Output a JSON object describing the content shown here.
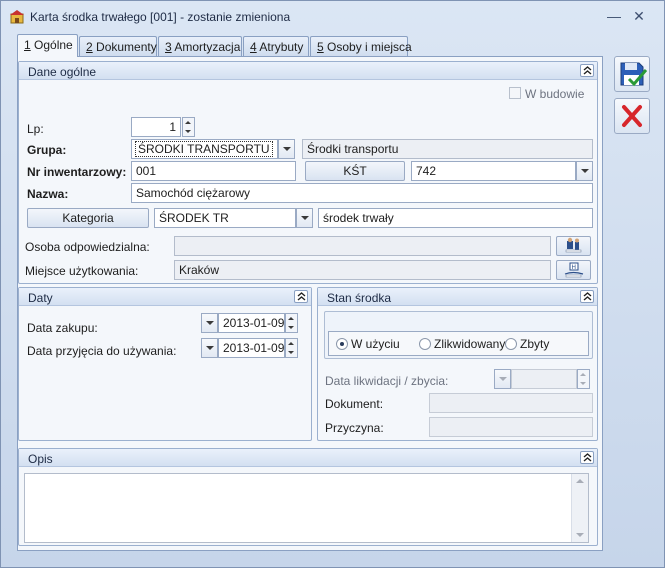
{
  "window": {
    "title": "Karta środka trwałego [001] - zostanie zmieniona"
  },
  "tabs": [
    {
      "key": "1",
      "label": " Ogólne"
    },
    {
      "key": "2",
      "label": " Dokumenty"
    },
    {
      "key": "3",
      "label": " Amortyzacja"
    },
    {
      "key": "4",
      "label": " Atrybuty"
    },
    {
      "key": "5",
      "label": " Osoby i miejsca"
    }
  ],
  "dane_ogolne": {
    "title": "Dane ogólne",
    "w_budowie_label": "W budowie",
    "w_budowie_checked": false,
    "lp_label": "Lp:",
    "lp_value": "1",
    "grupa_label": "Grupa:",
    "grupa_value": "ŚRODKI TRANSPORTU",
    "grupa_desc": "Środki transportu",
    "nr_label": "Nr inwentarzowy:",
    "nr_value": "001",
    "kst_button": "KŚT",
    "kst_value": "742",
    "nazwa_label": "Nazwa:",
    "nazwa_value": "Samochód ciężarowy",
    "kategoria_button": "Kategoria",
    "kategoria_value": "ŚRODEK TR",
    "kategoria_desc": "środek trwały",
    "osoba_label": "Osoba odpowiedzialna:",
    "osoba_value": "",
    "miejsce_label": "Miejsce użytkowania:",
    "miejsce_value": "Kraków"
  },
  "daty": {
    "title": "Daty",
    "zakup_label": "Data zakupu:",
    "zakup_value": "2013-01-09",
    "przyjecie_label": "Data przyjęcia do używania:",
    "przyjecie_value": "2013-01-09"
  },
  "stan": {
    "title": "Stan środka",
    "options": [
      "W użyciu",
      "Zlikwidowany",
      "Zbyty"
    ],
    "selected": "W użyciu",
    "likwidacja_label": "Data likwidacji / zbycia:",
    "likwidacja_value": "",
    "dokument_label": "Dokument:",
    "dokument_value": "",
    "przyczyna_label": "Przyczyna:",
    "przyczyna_value": ""
  },
  "opis": {
    "title": "Opis",
    "value": ""
  },
  "colors": {
    "accent": "#d7262b",
    "save": "#2c5fb8",
    "frame": "#8aa0c2"
  },
  "icons": {
    "save": "save-icon",
    "cancel": "cancel-icon",
    "person": "person-icon",
    "location": "location-icon"
  }
}
